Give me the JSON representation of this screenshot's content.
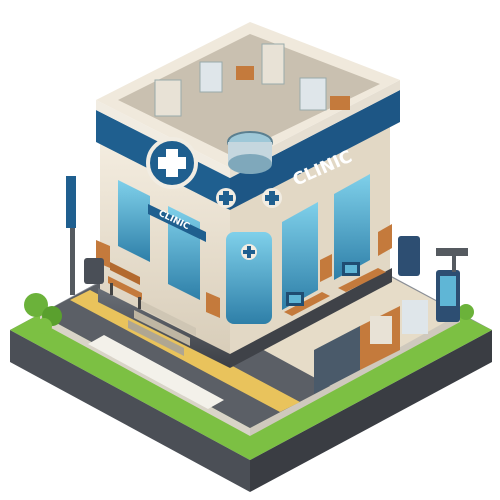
{
  "signs": {
    "main": "CLINIC",
    "awning": "CLINIC"
  },
  "colors": {
    "primary_blue": "#1f5f8f",
    "trim_cream": "#efe6d6",
    "glass": "#5fb6d6",
    "ground_gray": "#5b5f66",
    "grass": "#7cc043",
    "path_yellow": "#e9c35c",
    "wood": "#c47a3c"
  },
  "icons": [
    "medical-cross-icon"
  ]
}
